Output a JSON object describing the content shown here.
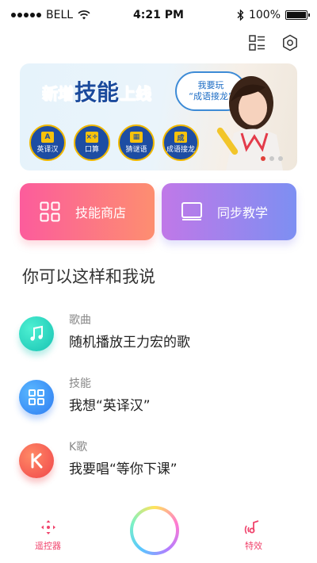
{
  "status": {
    "carrier": "BELL",
    "time": "4:21 PM",
    "battery": "100%"
  },
  "banner": {
    "title_parts": [
      "新增",
      "技能",
      "上线"
    ],
    "speech_line1": "我要玩",
    "speech_line2": "“成语接龙”",
    "skills": [
      {
        "glyph": "A",
        "label": "英译汉"
      },
      {
        "glyph": "×÷",
        "label": "口算"
      },
      {
        "glyph": "▦",
        "label": "猜谜语"
      },
      {
        "glyph": "成",
        "label": "成语接龙"
      }
    ]
  },
  "cards": {
    "store": "技能商店",
    "teach": "同步教学"
  },
  "section_title": "你可以这样和我说",
  "suggestions": [
    {
      "category": "歌曲",
      "text": "随机播放王力宏的歌"
    },
    {
      "category": "技能",
      "text": "我想“英译汉”"
    },
    {
      "category": "K歌",
      "text": "我要唱“等你下课”"
    }
  ],
  "bottom_nav": {
    "remote": "遥控器",
    "effects": "特效"
  },
  "colors": {
    "accent": "#f0436c",
    "store_gradient": [
      "#fc5c9c",
      "#fd8e70"
    ],
    "teach_gradient": [
      "#c078e8",
      "#7d8ff2"
    ]
  }
}
